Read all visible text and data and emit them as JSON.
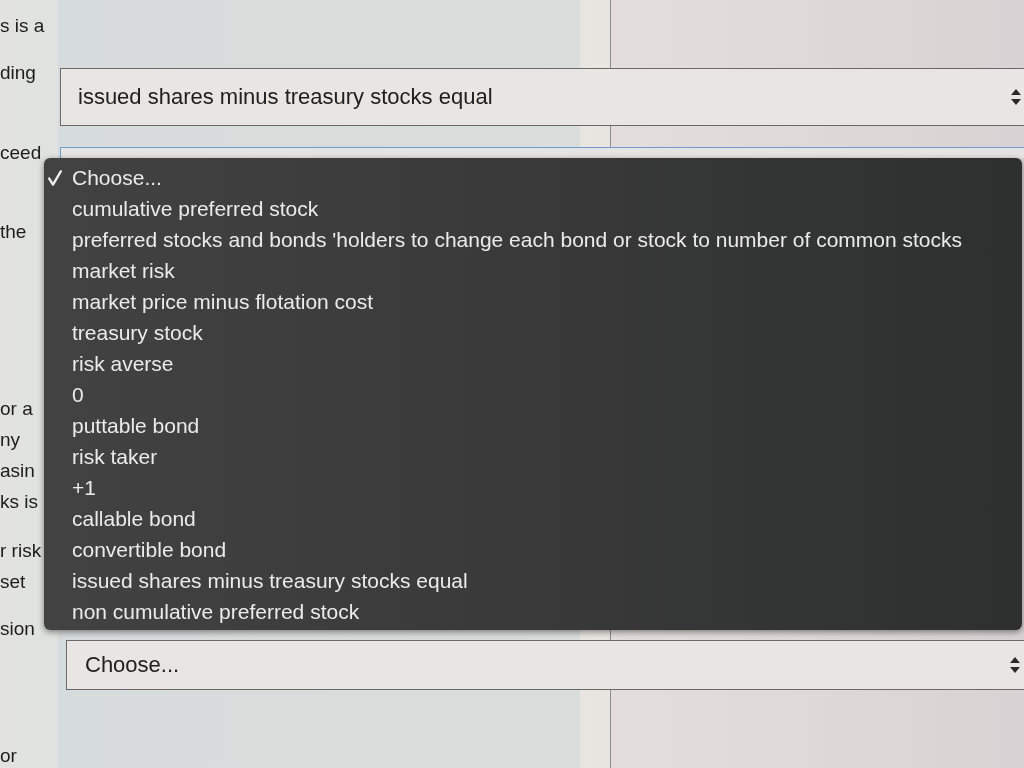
{
  "questions": [
    {
      "text_lines": [
        "s is a",
        "ding"
      ],
      "answer": {
        "value": "issued shares minus treasury stocks equal",
        "focused": false
      }
    },
    {
      "text_lines": [
        "ceed",
        "the"
      ],
      "answer": {
        "focused": true,
        "open_menu": {
          "options": [
            {
              "label": "Choose...",
              "selected": true
            },
            {
              "label": "cumulative preferred stock",
              "selected": false
            },
            {
              "label": "preferred stocks and bonds 'holders to change each bond or stock to number of common stocks",
              "selected": false
            },
            {
              "label": "market risk",
              "selected": false
            },
            {
              "label": "market price minus flotation cost",
              "selected": false
            },
            {
              "label": "treasury stock",
              "selected": false
            },
            {
              "label": "risk averse",
              "selected": false
            },
            {
              "label": "0",
              "selected": false
            },
            {
              "label": "puttable bond",
              "selected": false
            },
            {
              "label": "risk taker",
              "selected": false
            },
            {
              "label": "+1",
              "selected": false
            },
            {
              "label": "callable bond",
              "selected": false
            },
            {
              "label": "convertible bond",
              "selected": false
            },
            {
              "label": "issued shares minus treasury stocks equal",
              "selected": false
            },
            {
              "label": "non cumulative preferred stock",
              "selected": false
            }
          ]
        }
      }
    },
    {
      "text_lines": [
        "or a",
        "ny",
        "asin",
        "ks is"
      ]
    },
    {
      "text_lines": [
        "r risk",
        "set"
      ]
    },
    {
      "text_lines": [
        "sion"
      ],
      "answer": {
        "value": "Choose...",
        "focused": false
      }
    },
    {
      "text_lines": [
        "or"
      ]
    }
  ]
}
